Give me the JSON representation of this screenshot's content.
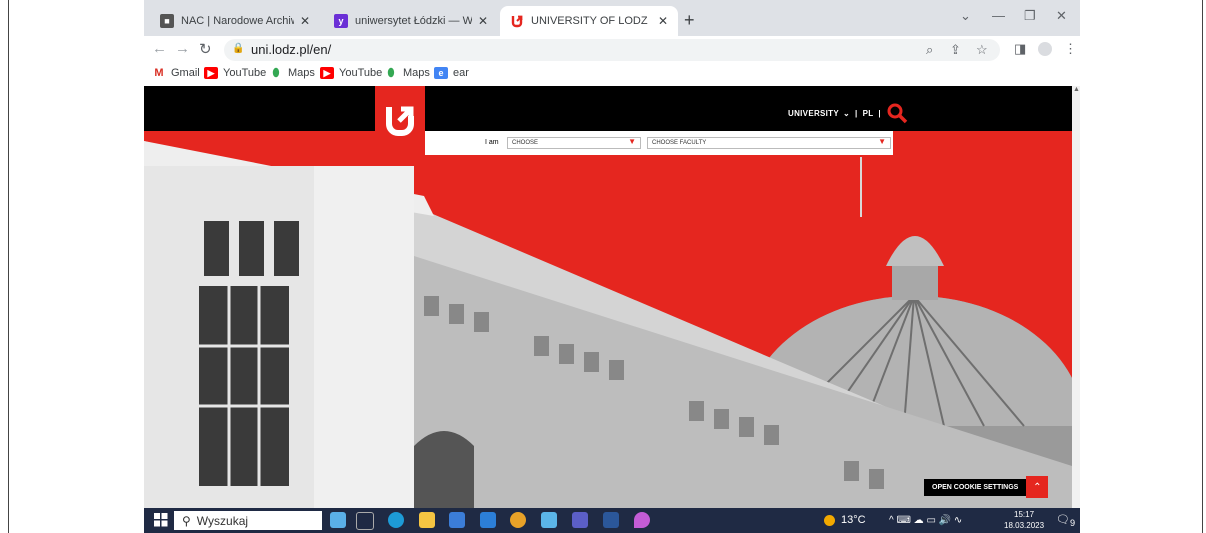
{
  "browser": {
    "tabs": [
      {
        "title": "NAC | Narodowe Archiwum Cyfr",
        "favicon_color": "#555555",
        "active": false
      },
      {
        "title": "uniwersytet Łódzki — Wyniki wys",
        "favicon_color": "#6b2fd6",
        "active": false
      },
      {
        "title": "UNIVERSITY OF LODZ",
        "favicon_color": "#e5261f",
        "active": true
      }
    ],
    "new_tab_glyph": "+",
    "url": "uni.lodz.pl/en/",
    "bookmarks": [
      {
        "label": "Gmail",
        "icon": "gmail-icon",
        "color": "#d93025"
      },
      {
        "label": "YouTube",
        "icon": "youtube-icon",
        "color": "#ff0000"
      },
      {
        "label": "Maps",
        "icon": "maps-icon",
        "color": "#34a853"
      },
      {
        "label": "YouTube",
        "icon": "youtube-icon",
        "color": "#ff0000"
      },
      {
        "label": "Maps",
        "icon": "maps-icon",
        "color": "#34a853"
      },
      {
        "label": "ear",
        "icon": "ear-icon",
        "color": "#4285f4"
      }
    ]
  },
  "site": {
    "nav_university": "UNIVERSITY",
    "nav_lang": "PL",
    "iam_label": "I am",
    "choose_placeholder": "CHOOSE",
    "faculty_placeholder": "CHOOSE FACULTY",
    "cookie_button": "OPEN COOKIE SETTINGS",
    "accent": "#e5261f"
  },
  "taskbar": {
    "search_text": "Wyszukaj",
    "temperature": "13°C",
    "time": "15:17",
    "date": "18.03.2023",
    "notification_count": "9"
  }
}
